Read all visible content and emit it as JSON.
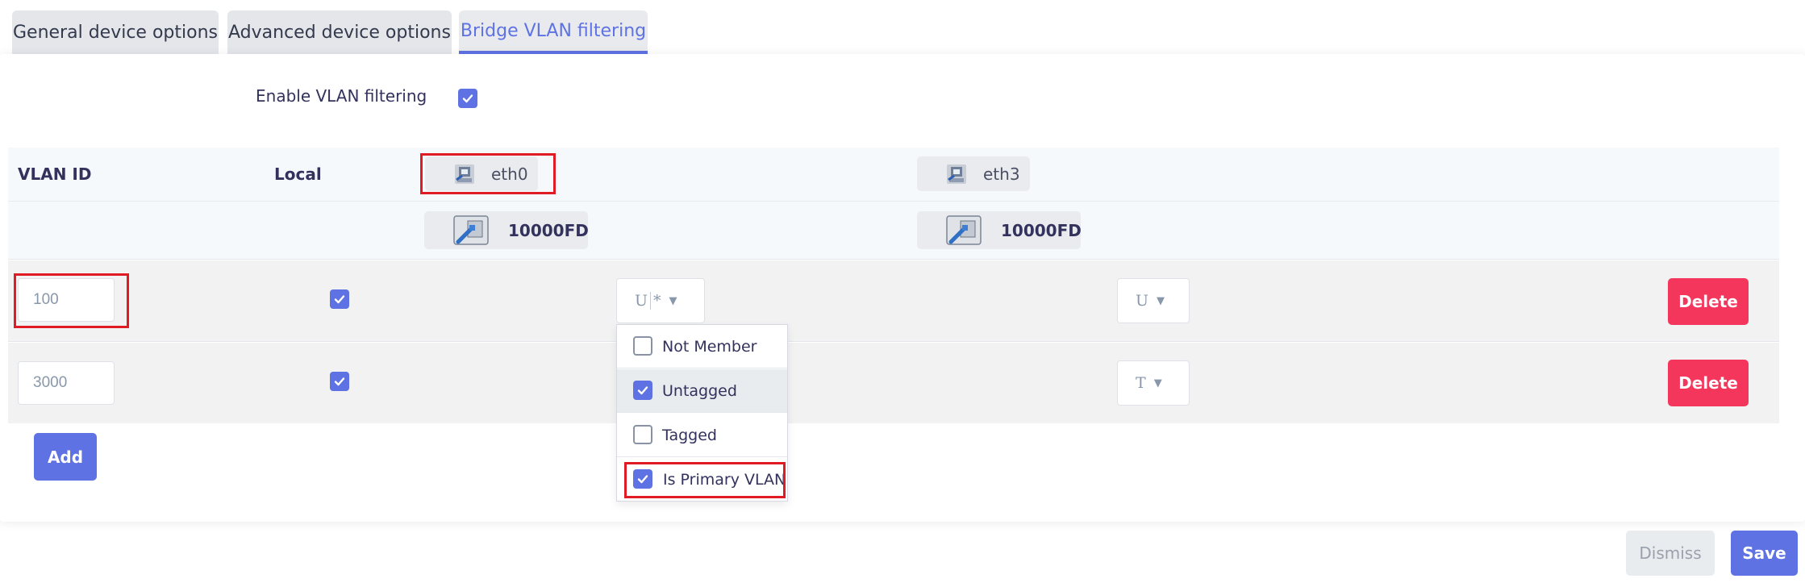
{
  "tabs": [
    {
      "label": "General device options"
    },
    {
      "label": "Advanced device options"
    },
    {
      "label": "Bridge VLAN filtering"
    }
  ],
  "filtering": {
    "label": "Enable VLAN filtering",
    "checked": true
  },
  "table": {
    "headers": {
      "vlan_id": "VLAN ID",
      "local": "Local"
    },
    "ports": [
      {
        "name": "eth0",
        "speed": "10000FD"
      },
      {
        "name": "eth3",
        "speed": "10000FD"
      }
    ],
    "rows": [
      {
        "vlan_id": "100",
        "local": true,
        "eth0": "U",
        "eth0_flag": "*",
        "eth3": "U",
        "delete_label": "Delete"
      },
      {
        "vlan_id": "3000",
        "local": true,
        "eth3": "T",
        "delete_label": "Delete"
      }
    ]
  },
  "dropdown": {
    "items": [
      {
        "label": "Not Member",
        "checked": false
      },
      {
        "label": "Untagged",
        "checked": true
      },
      {
        "label": "Tagged",
        "checked": false
      },
      {
        "label": "Is Primary VLAN",
        "checked": true
      }
    ]
  },
  "buttons": {
    "add": "Add",
    "dismiss": "Dismiss",
    "save": "Save"
  },
  "colors": {
    "primary": "#5e72e4",
    "danger": "#f5365c",
    "highlight": "#e01b24"
  }
}
